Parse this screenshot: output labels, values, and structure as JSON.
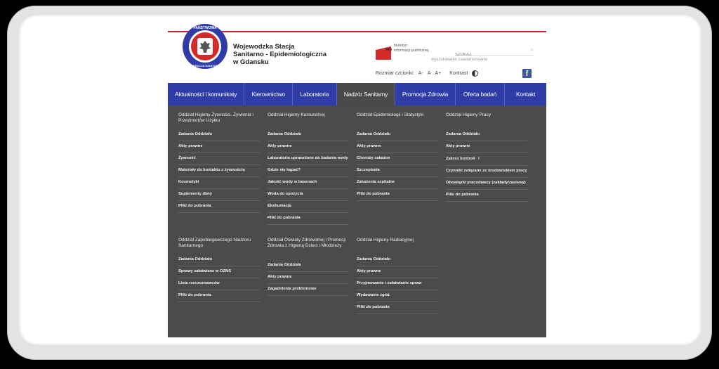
{
  "header": {
    "org_line1": "Wojewodzka Stacja",
    "org_line2": "Sanitarno - Epidemiologiczna",
    "org_line3": "w Gdansku",
    "logo_top_text": "PAŃSTWOWA",
    "logo_bottom_text": "INSPEKCJA SANITARNA",
    "bip_label": "bip",
    "bip_line1": "biuletyn",
    "bip_line2": "informacji publicznej",
    "search_placeholder": "SZUKAJ",
    "advanced_search": "wyszukiwanie zaawansowane",
    "font_size_label": "Rozmiar czcionki:",
    "font_small": "A-",
    "font_normal": "A",
    "font_large": "A+",
    "contrast_label": "Kontrast",
    "facebook": "f"
  },
  "nav": {
    "items": [
      {
        "label": "Aktualności i komunikaty"
      },
      {
        "label": "Kierownictwo"
      },
      {
        "label": "Laboratoria"
      },
      {
        "label": "Nadzór Sanitarny"
      },
      {
        "label": "Promocja Zdrowia"
      },
      {
        "label": "Oferta badań"
      },
      {
        "label": "Kontakt"
      }
    ],
    "active": "Nadzór Sanitarny"
  },
  "mega": {
    "col1": {
      "title": "Oddział Higieny Żywności, Żywienia i Przedmiotów Użytku",
      "links": [
        "Zadania Oddziału",
        "Akty prawne",
        "Żywność",
        "Materiały do kontaktu z żywnością",
        "Kosmetyki",
        "Suplementy diety",
        "Pliki do pobrania"
      ]
    },
    "col2": {
      "title": "Oddział Higieny Komunalnej",
      "links": [
        "Zadania Oddziału",
        "Akty prawne",
        "Laboratoria uprawnione do badania wody",
        "Gdzie się kąpać?",
        "Jakość wody w basenach",
        "Woda do spożycia",
        "Ekshumacja",
        "Pliki do pobrania"
      ]
    },
    "col3": {
      "title": "Oddział Epidemiologii i Statystyki",
      "links": [
        "Zadania Oddziału",
        "Akty prawne",
        "Choroby zakaźne",
        "Szczepienia",
        "Zakażenia szpitalne",
        "Pliki do pobrania"
      ]
    },
    "col4": {
      "title": "Oddział Higieny Pracy",
      "links": [
        "Zadania Oddziału",
        "Akty prawne",
        "Zakres kontroli",
        "Czynniki związane ze środowiskiem pracy",
        "Obowiązki pracodawcy (zakłady/zasiewy)",
        "Pliki do pobrania"
      ]
    },
    "col5": {
      "title": "Oddział Zapobiegawczego Nadzoru Sanitarnego",
      "links": [
        "Zadania Oddziału",
        "Sprawy załatwiane w OZNS",
        "Lista rzeczoznawców",
        "Pliki do pobrania"
      ]
    },
    "col6": {
      "title": "Oddział Oświaty Zdrowotnej i Promocji Zdrowia z Higieną Dzieci i Młodzieży",
      "links": [
        "Zadania Oddziału",
        "Akty prawne",
        "Zagadnienia problemowe"
      ]
    },
    "col7": {
      "title": "Oddział Higieny Radiacyjnej",
      "links": [
        "Zadania Oddziału",
        "Akty prawne",
        "Przyjmowanie i załatwianie spraw",
        "Wydawanie zgód",
        "Pliki do pobrania"
      ]
    },
    "chevron": "›"
  },
  "colors": {
    "nav_bg": "#2f3ba6",
    "menu_bg": "#4b4b4b",
    "accent_red": "#c42230"
  }
}
